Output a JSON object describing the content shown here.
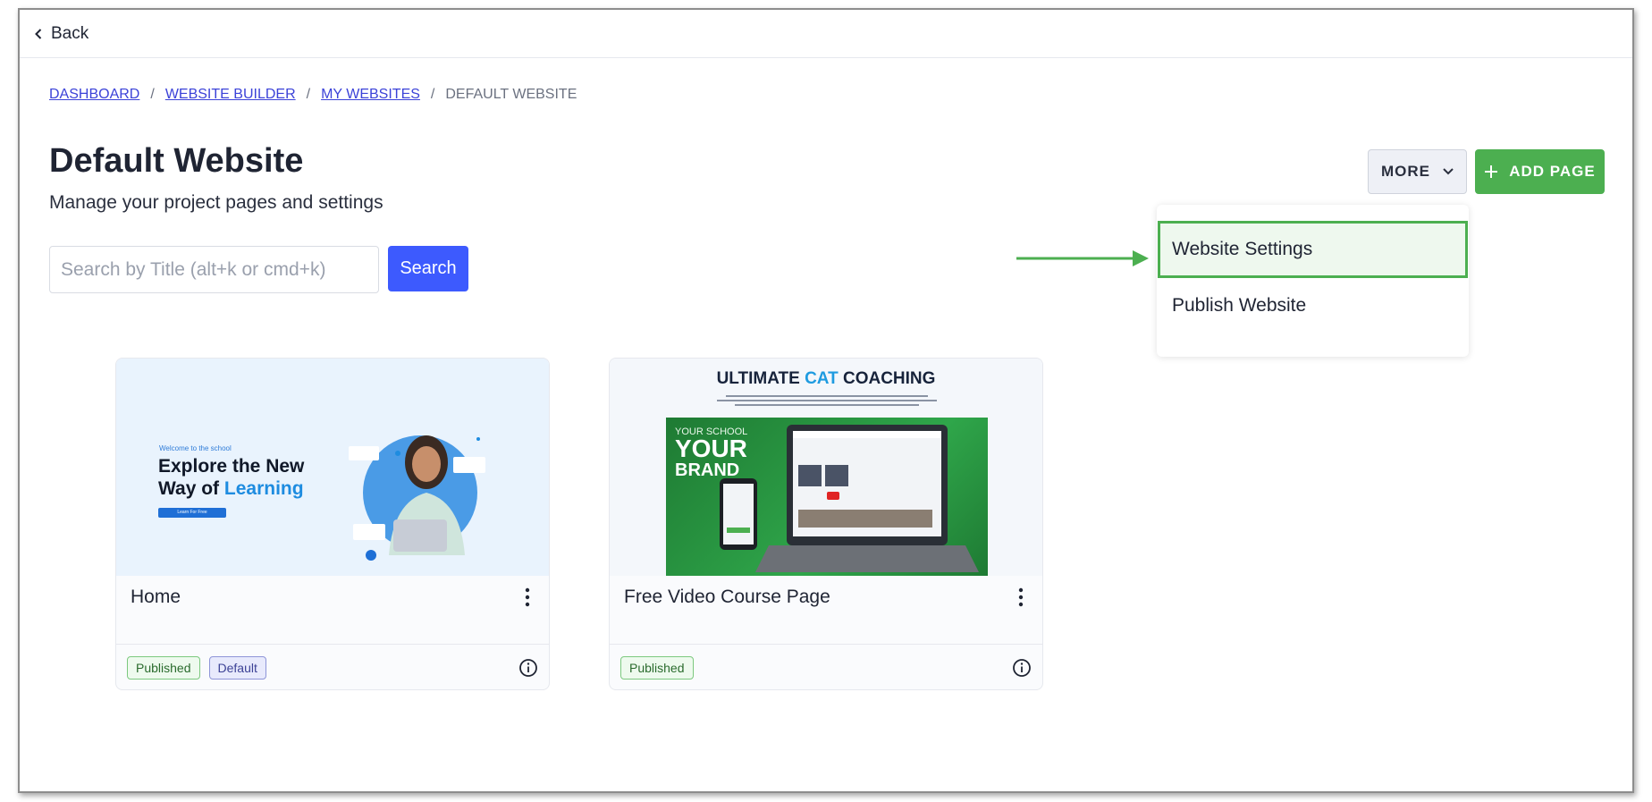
{
  "topbar": {
    "back_label": "Back"
  },
  "breadcrumb": {
    "items": [
      "DASHBOARD",
      "WEBSITE BUILDER",
      "MY WEBSITES"
    ],
    "current": "DEFAULT WEBSITE",
    "separator": "/"
  },
  "header": {
    "title": "Default Website",
    "subtitle": "Manage your project pages and settings",
    "more_label": "MORE",
    "add_page_label": "ADD PAGE"
  },
  "search": {
    "placeholder": "Search by Title (alt+k or cmd+k)",
    "value": "",
    "button_label": "Search"
  },
  "dropdown": {
    "items": [
      {
        "label": "Website Settings",
        "highlighted": true
      },
      {
        "label": "Publish Website",
        "highlighted": false
      }
    ]
  },
  "colors": {
    "primary_blue": "#3d5afe",
    "accent_green": "#4caf50",
    "link_blue": "#3b42d8"
  },
  "cards": [
    {
      "title": "Home",
      "badges": [
        "Published",
        "Default"
      ],
      "thumbnail": {
        "welcome": "Welcome to the school",
        "headline_line1": "Explore the New",
        "headline_prefix": "Way of ",
        "headline_accent": "Learning",
        "cta": "Learn For Free"
      }
    },
    {
      "title": "Free Video Course Page",
      "badges": [
        "Published"
      ],
      "thumbnail": {
        "title_prefix": "ULTIMATE ",
        "title_accent": "CAT",
        "title_suffix": " COACHING",
        "your_school": "YOUR SCHOOL",
        "your": "YOUR",
        "brand": "BRAND"
      }
    }
  ]
}
